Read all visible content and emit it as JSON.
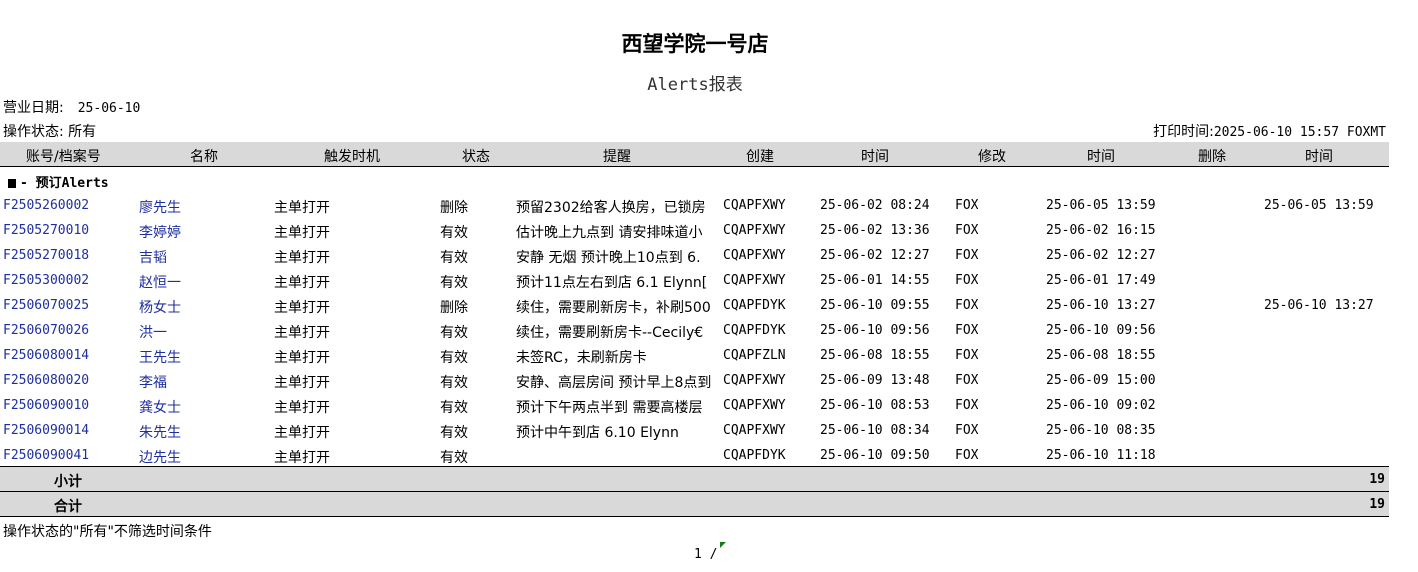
{
  "report": {
    "title": "西望学院一号店",
    "subtitle": "Alerts报表",
    "business_date_label": "营业日期:",
    "business_date": "25-06-10",
    "status_label": "操作状态: 所有",
    "print_time_label": "打印时间:",
    "print_time": "2025-06-10 15:57 FOXMT"
  },
  "columns": [
    "账号/档案号",
    "名称",
    "触发时机",
    "状态",
    "提醒",
    "创建",
    "时间",
    "修改",
    "时间",
    "删除",
    "时间"
  ],
  "group": {
    "label": "- 预订Alerts"
  },
  "rows": [
    [
      "F2505260002",
      "廖先生",
      "主单打开",
      "删除",
      "预留2302给客人换房，已锁房",
      "CQAPFXWY",
      "25-06-02 08:24",
      "FOX",
      "25-06-05 13:59",
      "",
      "25-06-05 13:59"
    ],
    [
      "F2505270010",
      "李婷婷",
      "主单打开",
      "有效",
      "估计晚上九点到 请安排味道小",
      "CQAPFXWY",
      "25-06-02 13:36",
      "FOX",
      "25-06-02 16:15",
      "",
      ""
    ],
    [
      "F2505270018",
      "吉韬",
      "主单打开",
      "有效",
      "安静 无烟 预计晚上10点到 6.",
      "CQAPFXWY",
      "25-06-02 12:27",
      "FOX",
      "25-06-02 12:27",
      "",
      ""
    ],
    [
      "F2505300002",
      "赵恒一",
      "主单打开",
      "有效",
      "预计11点左右到店 6.1 Elynn[",
      "CQAPFXWY",
      "25-06-01 14:55",
      "FOX",
      "25-06-01 17:49",
      "",
      ""
    ],
    [
      "F2506070025",
      "杨女士",
      "主单打开",
      "删除",
      "续住，需要刷新房卡，补刷500",
      "CQAPFDYK",
      "25-06-10 09:55",
      "FOX",
      "25-06-10 13:27",
      "",
      "25-06-10 13:27"
    ],
    [
      "F2506070026",
      "洪一",
      "主单打开",
      "有效",
      "续住，需要刷新房卡--Cecily€",
      "CQAPFDYK",
      "25-06-10 09:56",
      "FOX",
      "25-06-10 09:56",
      "",
      ""
    ],
    [
      "F2506080014",
      "王先生",
      "主单打开",
      "有效",
      "未签RC，未刷新房卡",
      "CQAPFZLN",
      "25-06-08 18:55",
      "FOX",
      "25-06-08 18:55",
      "",
      ""
    ],
    [
      "F2506080020",
      "李福",
      "主单打开",
      "有效",
      "安静、高层房间 预计早上8点到",
      "CQAPFXWY",
      "25-06-09 13:48",
      "FOX",
      "25-06-09 15:00",
      "",
      ""
    ],
    [
      "F2506090010",
      "龚女士",
      "主单打开",
      "有效",
      "预计下午两点半到 需要高楼层",
      "CQAPFXWY",
      "25-06-10 08:53",
      "FOX",
      "25-06-10 09:02",
      "",
      ""
    ],
    [
      "F2506090014",
      "朱先生",
      "主单打开",
      "有效",
      "预计中午到店  6.10 Elynn",
      "CQAPFXWY",
      "25-06-10 08:34",
      "FOX",
      "25-06-10 08:35",
      "",
      ""
    ],
    [
      "F2506090041",
      "边先生",
      "主单打开",
      "有效",
      "",
      "CQAPFDYK",
      "25-06-10 09:50",
      "FOX",
      "25-06-10 11:18",
      "",
      ""
    ]
  ],
  "subtotal": {
    "label": "小计",
    "value": "19"
  },
  "total": {
    "label": "合计",
    "value": "19"
  },
  "footnote": "操作状态的\"所有\"不筛选时间条件",
  "page_indicator": "1 /"
}
